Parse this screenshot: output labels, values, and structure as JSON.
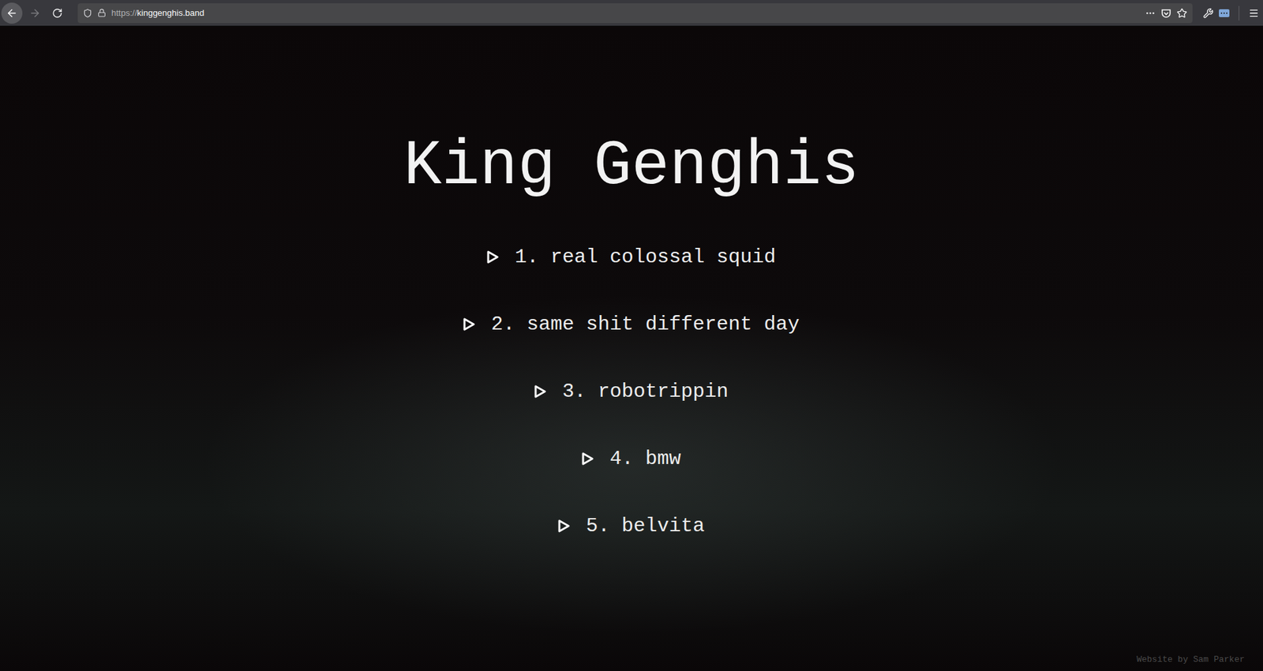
{
  "browser": {
    "url_scheme": "https://",
    "url_host": "kinggenghis.band",
    "back_enabled": true,
    "forward_enabled": false
  },
  "page": {
    "title": "King Genghis",
    "tracks": [
      {
        "label": "1. real colossal squid"
      },
      {
        "label": "2. same shit different day"
      },
      {
        "label": "3. robotrippin"
      },
      {
        "label": "4. bmw"
      },
      {
        "label": "5. belvita"
      }
    ],
    "credit": "Website by Sam Parker"
  }
}
